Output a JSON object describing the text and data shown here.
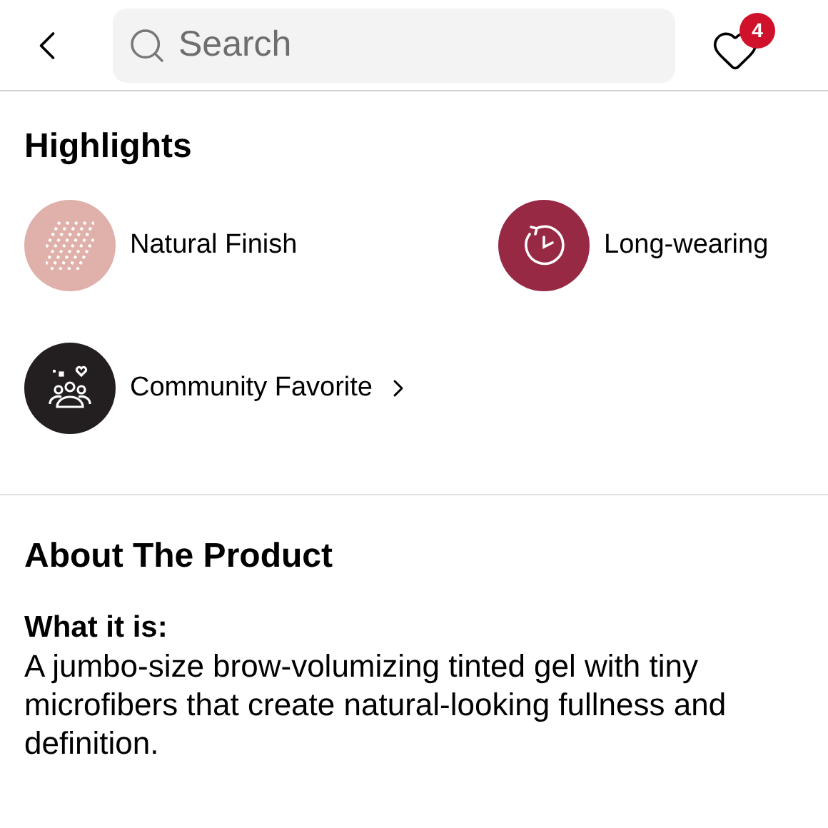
{
  "header": {
    "search": {
      "placeholder": "Search"
    },
    "favorites_count": "4"
  },
  "highlights": {
    "title": "Highlights",
    "items": [
      {
        "label": "Natural Finish",
        "kind": "stripes",
        "color": "#e0b0aa",
        "link": false
      },
      {
        "label": "Long-wearing",
        "kind": "clock",
        "color": "#982944",
        "link": false
      },
      {
        "label": "Community Favorite",
        "kind": "community",
        "color": "#231f20",
        "link": true
      }
    ]
  },
  "about": {
    "title": "About The Product",
    "subtitle": "What it is:",
    "text": "A jumbo-size brow-volumizing tinted gel with tiny microfibers that create natural-looking fullness and definition."
  }
}
